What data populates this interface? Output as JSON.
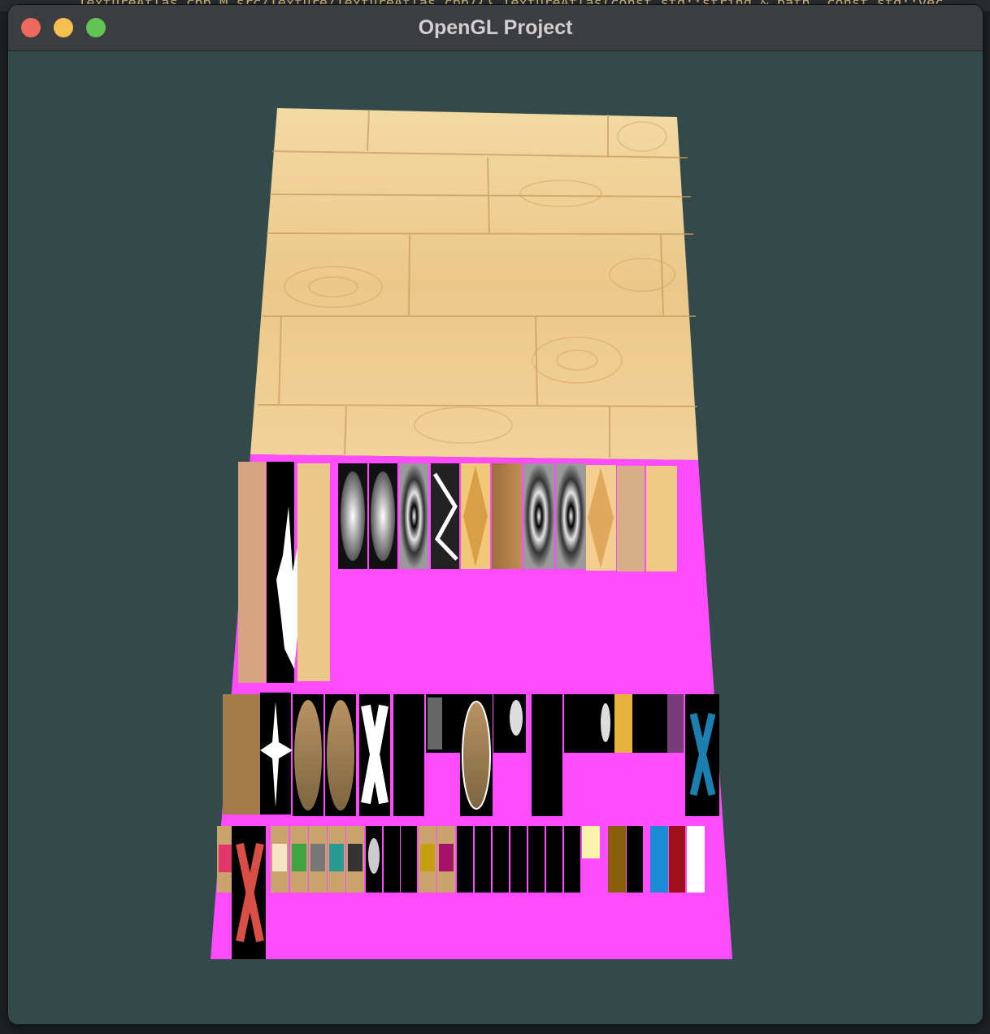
{
  "window": {
    "title": "OpenGL Project",
    "buttons": {
      "close": "close",
      "minimize": "minimize",
      "zoom": "zoom"
    }
  },
  "background_editor": {
    "visible_text": "TextureAtlas.cpp M  src/Texture/TextureAtlas.cpp/{} TextureAtlas(const std::string & path, const std::vec"
  },
  "scene": {
    "clear_color": "#334a4b",
    "atlas_fill_color": "#ff4cff",
    "upper_texture": "wood-planks",
    "lower_texture": "texture-atlas"
  },
  "colors": {
    "wood_light": "#f3d49a",
    "wood_mid": "#e2b66f",
    "wood_dark": "#c89448",
    "magenta": "#ff4cff"
  }
}
